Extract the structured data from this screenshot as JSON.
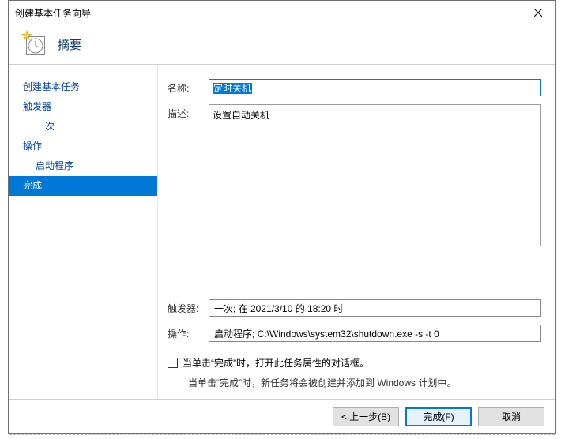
{
  "dialog": {
    "title": "创建基本任务向导",
    "header_title": "摘要"
  },
  "sidebar": {
    "items": [
      {
        "label": "创建基本任务",
        "link": true,
        "sub": false,
        "selected": false
      },
      {
        "label": "触发器",
        "link": true,
        "sub": false,
        "selected": false
      },
      {
        "label": "一次",
        "link": true,
        "sub": true,
        "selected": false
      },
      {
        "label": "操作",
        "link": true,
        "sub": false,
        "selected": false
      },
      {
        "label": "启动程序",
        "link": true,
        "sub": true,
        "selected": false
      },
      {
        "label": "完成",
        "link": false,
        "sub": false,
        "selected": true
      }
    ]
  },
  "form": {
    "name_label": "名称:",
    "name_value": "定时关机",
    "desc_label": "描述:",
    "desc_value": "设置自动关机",
    "trigger_label": "触发器:",
    "trigger_value": "一次;  在 2021/3/10 的 18:20 时",
    "action_label": "操作:",
    "action_value": "启动程序;  C:\\Windows\\system32\\shutdown.exe -s -t 0",
    "checkbox_label": "当单击“完成”时，打开此任务属性的对话框。",
    "info_text": "当单击“完成”时，新任务将会被创建并添加到 Windows 计划中。"
  },
  "buttons": {
    "back": "< 上一步(B)",
    "finish": "完成(F)",
    "cancel": "取消"
  }
}
